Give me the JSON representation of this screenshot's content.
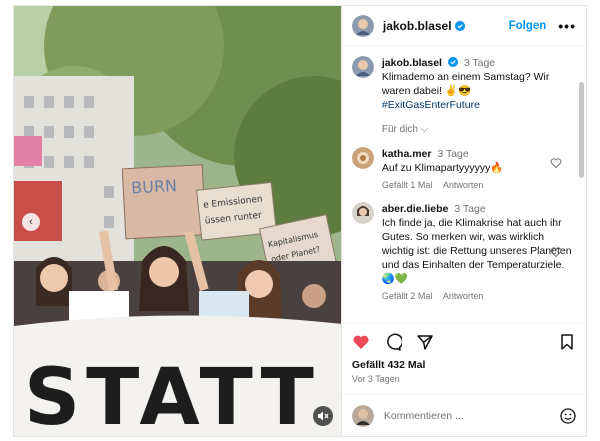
{
  "post": {
    "author": "jakob.blasel",
    "follow_label": "Folgen",
    "more_label": "•••",
    "caption_time": "3 Tage",
    "caption_line1": "Klimademo an einem Samstag? Wir waren dabei! ✌️😎",
    "hashtag": "#ExitGasEnterFuture",
    "for_you_label": "Für dich ⌵",
    "likes": "Gefällt 432 Mal",
    "posted_ago": "Vor 3 Tagen",
    "comment_placeholder": "Kommentieren ..."
  },
  "comments": [
    {
      "user": "katha.mer",
      "time": "3 Tage",
      "text": "Auf zu Klimapartyyyyyy🔥",
      "likes": "Gefällt 1 Mal",
      "reply": "Antworten"
    },
    {
      "user": "aber.die.liebe",
      "time": "3 Tage",
      "text": "Ich finde ja, die Klimakrise hat auch ihr Gutes. So merken wir, was wirklich wichtig ist: die Rettung unseres Planeten und das Einhalten der Temperaturziele. 🌏💚",
      "likes": "Gefällt 2 Mal",
      "reply": "Antworten"
    }
  ],
  "media": {
    "signs": [
      "BURN",
      "e Emissionen",
      "müssen runter",
      "Kapitalismus",
      "STATT"
    ],
    "nav_prev": "‹"
  },
  "colors": {
    "accent": "#0095f6",
    "like_red": "#ed4956",
    "verified": "#0095f6"
  },
  "icons": [
    "heart-icon",
    "comment-icon",
    "share-icon",
    "bookmark-icon",
    "emoji-icon",
    "mute-icon",
    "chevron-left-icon",
    "verified-icon",
    "more-icon"
  ]
}
